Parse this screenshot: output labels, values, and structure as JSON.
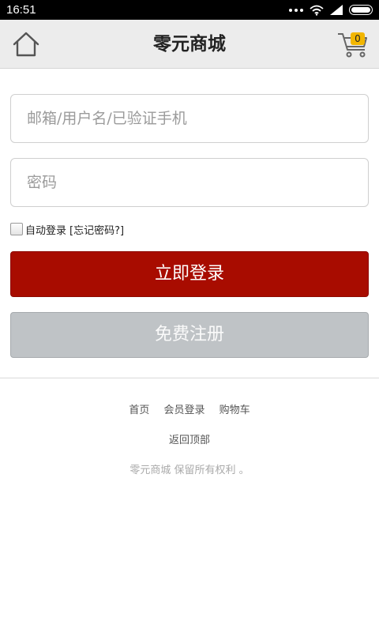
{
  "status_bar": {
    "time": "16:51"
  },
  "header": {
    "title": "零元商城",
    "cart_count": "0"
  },
  "form": {
    "username_placeholder": "邮箱/用户名/已验证手机",
    "password_placeholder": "密码",
    "remember_label": "自动登录",
    "forgot_link": "[忘记密码?]",
    "login_button": "立即登录",
    "register_button": "免费注册"
  },
  "footer": {
    "links": [
      "首页",
      "会员登录",
      "购物车"
    ],
    "back_to_top": "返回顶部",
    "copyright": "零元商城 保留所有权利 。"
  },
  "colors": {
    "primary": "#a80c00",
    "register": "#bfc3c6",
    "badge": "#f2b600"
  },
  "icons": {
    "home": "home-icon",
    "cart": "cart-icon"
  }
}
